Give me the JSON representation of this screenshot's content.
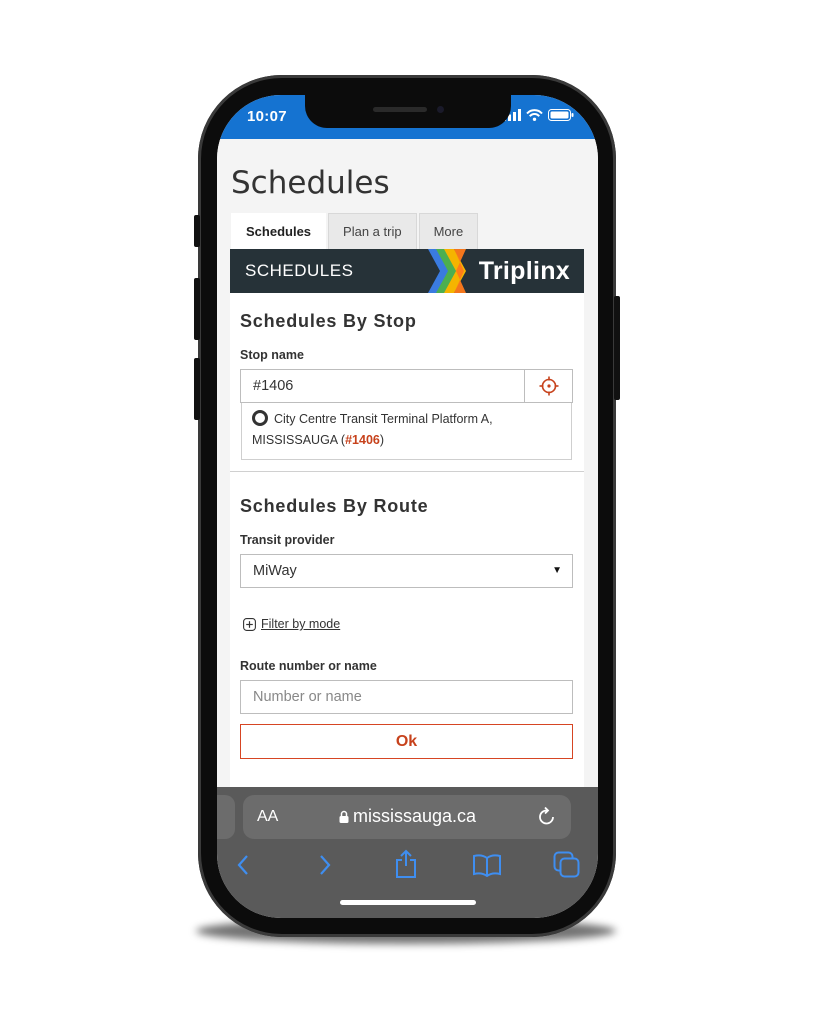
{
  "status_bar": {
    "time": "10:07"
  },
  "page": {
    "title": "Schedules",
    "tabs": [
      {
        "label": "Schedules",
        "active": true
      },
      {
        "label": "Plan a trip",
        "active": false
      },
      {
        "label": "More",
        "active": false
      }
    ]
  },
  "banner": {
    "heading": "SCHEDULES",
    "brand": "Triplinx"
  },
  "stop_section": {
    "title": "Schedules By Stop",
    "stop_label": "Stop name",
    "stop_value": "#1406",
    "suggestion": {
      "text_line1": "City Centre Transit Terminal Platform A,",
      "text_line2_prefix": "MISSISSAUGA (",
      "stop_number": "#1406",
      "text_line2_suffix": ")"
    }
  },
  "route_section": {
    "title": "Schedules By Route",
    "provider_label": "Transit provider",
    "provider_value": "MiWay",
    "filter_label": "Filter by mode",
    "route_label": "Route number or name",
    "route_placeholder": "Number or name",
    "ok_label": "Ok"
  },
  "browser": {
    "aa_label": "AA",
    "url": "mississauga.ca"
  },
  "colors": {
    "status_bar": "#1573d1",
    "accent": "#c7421c",
    "banner_bg": "#263238",
    "toolbar_bg": "#5a5a5a",
    "toolbar_icons": "#3f8ef0"
  }
}
